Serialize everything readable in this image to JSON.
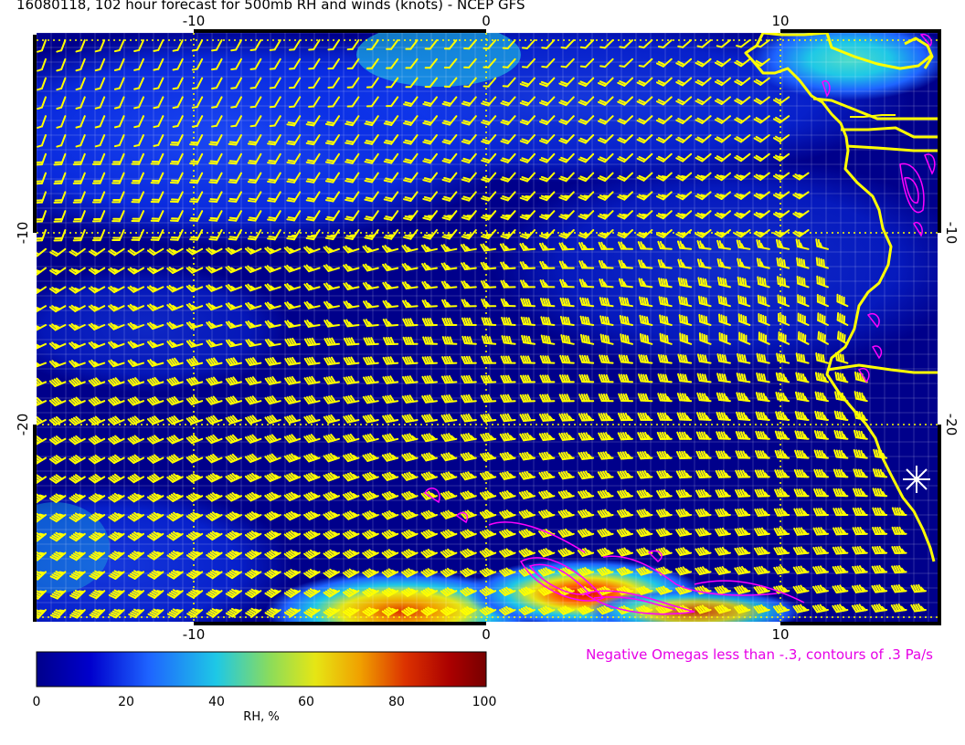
{
  "title": "16080118, 102 hour forecast for 500mb RH and winds (knots) - NCEP GFS",
  "x_tick_labels": [
    "-10",
    "0",
    "10"
  ],
  "y_tick_labels": [
    "-10",
    "-20"
  ],
  "colorbar": {
    "ticks": [
      "0",
      "20",
      "40",
      "60",
      "80",
      "100"
    ],
    "label": "RH, %",
    "stops": [
      "#00008b",
      "#0000cd",
      "#1e64ff",
      "#1ec8e6",
      "#8cdc5a",
      "#e6e614",
      "#f0a000",
      "#dc3200",
      "#aa0000",
      "#780000"
    ]
  },
  "omega_note": "Negative Omegas less than -.3, contours of .3 Pa/s",
  "colors": {
    "coastline": "#ffff00",
    "wind_barbs": "#ffff00",
    "omega_contours": "#ff00ff",
    "ocean_background": "#00008b",
    "grid": "#ffffff"
  },
  "icons": {
    "location_marker": "white-star-marker"
  }
}
